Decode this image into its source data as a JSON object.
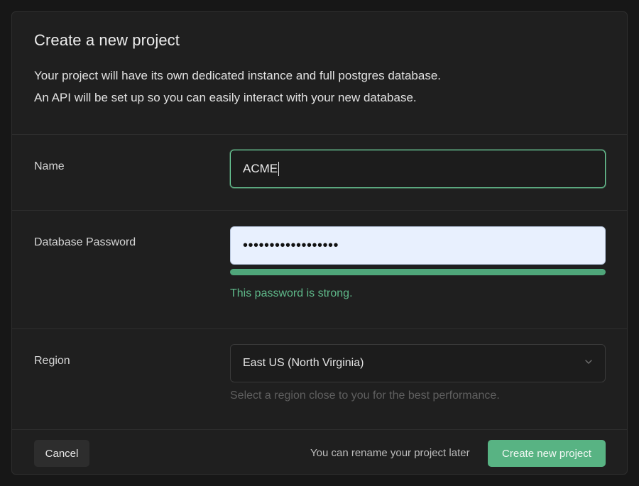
{
  "dialog": {
    "title": "Create a new project",
    "description_line1": "Your project will have its own dedicated instance and full postgres database.",
    "description_line2": "An API will be set up so you can easily interact with your new database."
  },
  "name_field": {
    "label": "Name",
    "value": "ACME"
  },
  "password_field": {
    "label": "Database Password",
    "masked_value": "••••••••••••••••••",
    "strength_fraction": 1.0,
    "strength_message": "This password is strong."
  },
  "region_field": {
    "label": "Region",
    "selected": "East US (North Virginia)",
    "hint": "Select a region close to you for the best performance."
  },
  "footer": {
    "cancel_label": "Cancel",
    "note": "You can rename your project later",
    "create_label": "Create new project"
  },
  "icons": {
    "dropdown": "chevron-down-icon"
  },
  "colors": {
    "accent": "#58b383",
    "strength_bar": "#4fa67a",
    "strength_text": "#5fb98a",
    "focus_border": "#6ccf9b"
  }
}
